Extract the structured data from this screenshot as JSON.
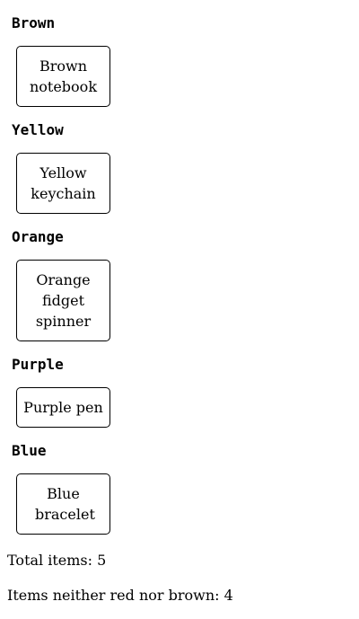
{
  "groups": [
    {
      "heading": "Brown",
      "item": "Brown notebook"
    },
    {
      "heading": "Yellow",
      "item": "Yellow keychain"
    },
    {
      "heading": "Orange",
      "item": "Orange fidget spinner"
    },
    {
      "heading": "Purple",
      "item": "Purple pen"
    },
    {
      "heading": "Blue",
      "item": "Blue bracelet"
    }
  ],
  "summary": {
    "total": "Total items: 5",
    "neither": "Items neither red nor brown: 4"
  }
}
